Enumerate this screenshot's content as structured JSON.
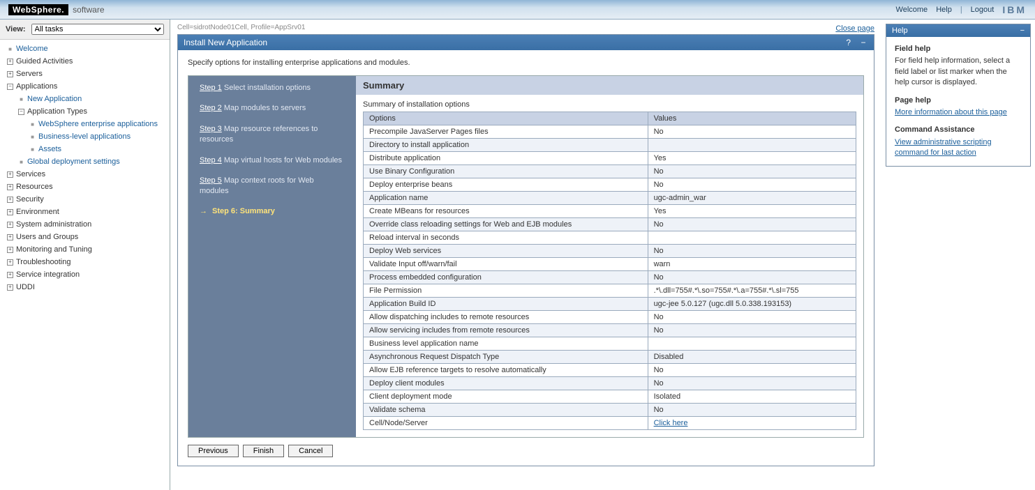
{
  "banner": {
    "logo_text": "WebSphere.",
    "logo_suffix": "software",
    "welcome": "Welcome",
    "help": "Help",
    "logout": "Logout",
    "ibm": "IBM"
  },
  "sidebar": {
    "view_label": "View:",
    "view_value": "All tasks",
    "items": {
      "welcome": "Welcome",
      "guided": "Guided Activities",
      "servers": "Servers",
      "applications": "Applications",
      "new_app": "New Application",
      "app_types": "Application Types",
      "ws_apps": "WebSphere enterprise applications",
      "biz_apps": "Business-level applications",
      "assets": "Assets",
      "global_deploy": "Global deployment settings",
      "services": "Services",
      "resources": "Resources",
      "security": "Security",
      "environment": "Environment",
      "sysadmin": "System administration",
      "users_groups": "Users and Groups",
      "monitoring": "Monitoring and Tuning",
      "troubleshooting": "Troubleshooting",
      "service_integration": "Service integration",
      "uddi": "UDDI"
    }
  },
  "main": {
    "breadcrumb": "Cell=sidrotNode01Cell, Profile=AppSrv01",
    "close_page": "Close page",
    "panel_title": "Install New Application",
    "description": "Specify options for installing enterprise applications and modules.",
    "steps": {
      "s1": {
        "label": "Step 1",
        "text": "Select installation options"
      },
      "s2": {
        "label": "Step 2",
        "text": "Map modules to servers"
      },
      "s3": {
        "label": "Step 3",
        "text": "Map resource references to resources"
      },
      "s4": {
        "label": "Step 4",
        "text": "Map virtual hosts for Web modules"
      },
      "s5": {
        "label": "Step 5",
        "text": "Map context roots for Web modules"
      },
      "s6": "Step 6: Summary"
    },
    "summary_title": "Summary",
    "summary_subtitle": "Summary of installation options",
    "table_headers": {
      "options": "Options",
      "values": "Values"
    },
    "rows": [
      {
        "opt": "Precompile JavaServer Pages files",
        "val": "No"
      },
      {
        "opt": "Directory to install application",
        "val": ""
      },
      {
        "opt": "Distribute application",
        "val": "Yes"
      },
      {
        "opt": "Use Binary Configuration",
        "val": "No"
      },
      {
        "opt": "Deploy enterprise beans",
        "val": "No"
      },
      {
        "opt": "Application name",
        "val": "ugc-admin_war"
      },
      {
        "opt": "Create MBeans for resources",
        "val": "Yes"
      },
      {
        "opt": "Override class reloading settings for Web and EJB modules",
        "val": "No"
      },
      {
        "opt": "Reload interval in seconds",
        "val": ""
      },
      {
        "opt": "Deploy Web services",
        "val": "No"
      },
      {
        "opt": "Validate Input off/warn/fail",
        "val": "warn"
      },
      {
        "opt": "Process embedded configuration",
        "val": "No"
      },
      {
        "opt": "File Permission",
        "val": ".*\\.dll=755#.*\\.so=755#.*\\.a=755#.*\\.sl=755"
      },
      {
        "opt": "Application Build ID",
        "val": "ugc-jee 5.0.127 (ugc.dll 5.0.338.193153)"
      },
      {
        "opt": "Allow dispatching includes to remote resources",
        "val": "No"
      },
      {
        "opt": "Allow servicing includes from remote resources",
        "val": "No"
      },
      {
        "opt": "Business level application name",
        "val": ""
      },
      {
        "opt": "Asynchronous Request Dispatch Type",
        "val": "Disabled"
      },
      {
        "opt": "Allow EJB reference targets to resolve automatically",
        "val": "No"
      },
      {
        "opt": "Deploy client modules",
        "val": "No"
      },
      {
        "opt": "Client deployment mode",
        "val": "Isolated"
      },
      {
        "opt": "Validate schema",
        "val": "No"
      },
      {
        "opt": "Cell/Node/Server",
        "val": "Click here",
        "link": true
      }
    ],
    "buttons": {
      "previous": "Previous",
      "finish": "Finish",
      "cancel": "Cancel"
    }
  },
  "help": {
    "title": "Help",
    "field_help_h": "Field help",
    "field_help_t": "For field help information, select a field label or list marker when the help cursor is displayed.",
    "page_help_h": "Page help",
    "page_help_link": "More information about this page",
    "cmd_assist_h": "Command Assistance",
    "cmd_assist_link": "View administrative scripting command for last action"
  }
}
